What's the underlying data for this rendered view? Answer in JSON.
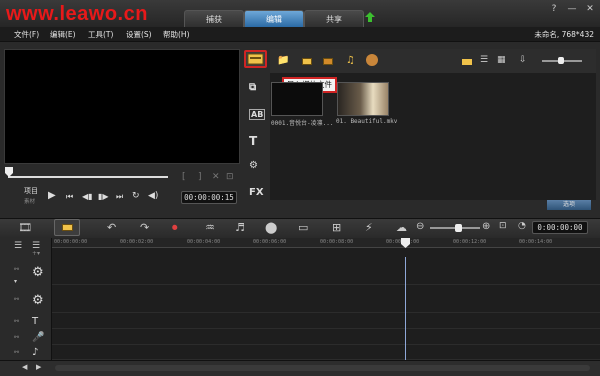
{
  "watermark": "www.leawo.cn",
  "tabs": [
    {
      "label": "捕获",
      "active": false
    },
    {
      "label": "编辑",
      "active": true
    },
    {
      "label": "共享",
      "active": false
    }
  ],
  "window_controls": {
    "help": "?",
    "minimize": "—",
    "close": "✕"
  },
  "menu": [
    "文件(F)",
    "编辑(E)",
    "工具(T)",
    "设置(S)",
    "帮助(H)"
  ],
  "project_info": "未命名, 768*432",
  "player": {
    "project_label": "项目",
    "source_label": "素材",
    "timecode": "00:00:00:15",
    "bracket_in": "[",
    "bracket_out": "]"
  },
  "library": {
    "tooltip": "导入媒体文件",
    "thumbnails": [
      {
        "label": "0001.音悦台-凌凛..."
      },
      {
        "label": "01. Beautiful.mkv"
      }
    ],
    "filter_button": "选项"
  },
  "sidebar_icons": [
    "media-library-icon",
    "transition-icon",
    "title-icon",
    "graphics-icon",
    "fx-icon"
  ],
  "side_text": {
    "title": "T",
    "fx": "FX",
    "ab": "AB"
  },
  "timeline": {
    "timecode": "0:00:00:00",
    "ruler_ticks": [
      "00:00:00:00",
      "00:00:02:00",
      "00:00:04:00",
      "00:00:06:00",
      "00:00:08:00",
      "00:00:10:00",
      "00:00:12:00",
      "00:00:14:00"
    ],
    "track_letter_t": "T"
  },
  "colors": {
    "accent": "#2b6aa5",
    "highlight": "#d02424",
    "watermark": "#e8191a"
  }
}
